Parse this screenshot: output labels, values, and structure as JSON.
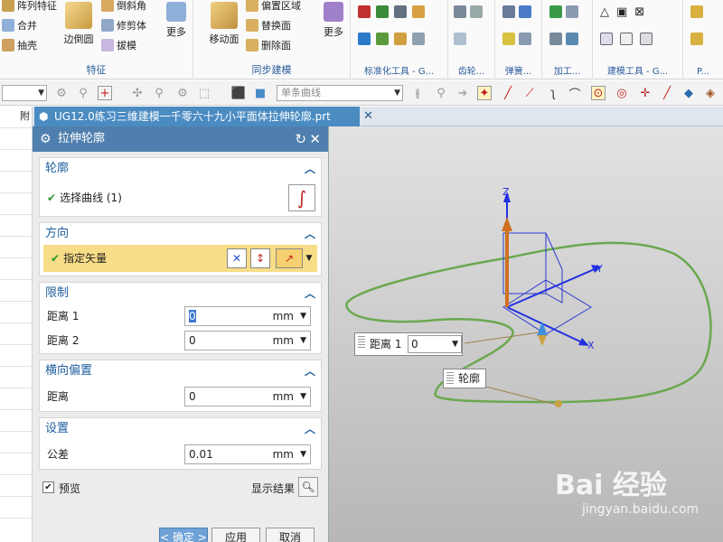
{
  "ribbon": {
    "feature_group": {
      "label": "特征",
      "items": [
        "阵列特征",
        "合并",
        "抽壳"
      ],
      "edge_blend": "边倒圆",
      "chamfer": "倒斜角",
      "trim_body": "修剪体",
      "draft": "拔模",
      "more": "更多"
    },
    "sync_group": {
      "label": "同步建模",
      "move_face": "移动面",
      "offset_region": "偏置区域",
      "replace_face": "替换面",
      "delete_face": "删除面",
      "more": "更多"
    },
    "std_tools": "标准化工具 - G...",
    "gear": "齿轮...",
    "spring": "弹簧...",
    "machining": "加工...",
    "modeling_tools": "建模工具 - G...",
    "more_tools": "P..."
  },
  "toolbar2": {
    "filter_combo": "",
    "curve_rule": "单条曲线"
  },
  "document": {
    "tab_title": "UG12.0练习三维建模一千零六十九小平面体拉伸轮廓.prt",
    "left_strip_header": "附"
  },
  "dialog": {
    "title": "拉伸轮廓",
    "section_profile": "轮廓",
    "select_curve": "选择曲线 (1)",
    "section_direction": "方向",
    "specify_vector": "指定矢量",
    "section_limits": "限制",
    "distance1_label": "距离 1",
    "distance1_value": "0",
    "distance2_label": "距离 2",
    "distance2_value": "0",
    "unit": "mm",
    "section_offset": "横向偏置",
    "offset_label": "距离",
    "offset_value": "0",
    "section_settings": "设置",
    "tolerance_label": "公差",
    "tolerance_value": "0.01",
    "preview_label": "预览",
    "show_result": "显示结果",
    "ok": "< 确定 >",
    "apply": "应用",
    "cancel": "取消"
  },
  "viewport": {
    "axis_z": "Z",
    "axis_y": "Y",
    "axis_x": "X",
    "distance_tag_label": "距离 1",
    "distance_tag_value": "0",
    "profile_tag": "轮廓",
    "curve_color": "#6aa84f"
  },
  "watermark": {
    "brand": "Bai  经验",
    "url": "jingyan.baidu.com"
  }
}
